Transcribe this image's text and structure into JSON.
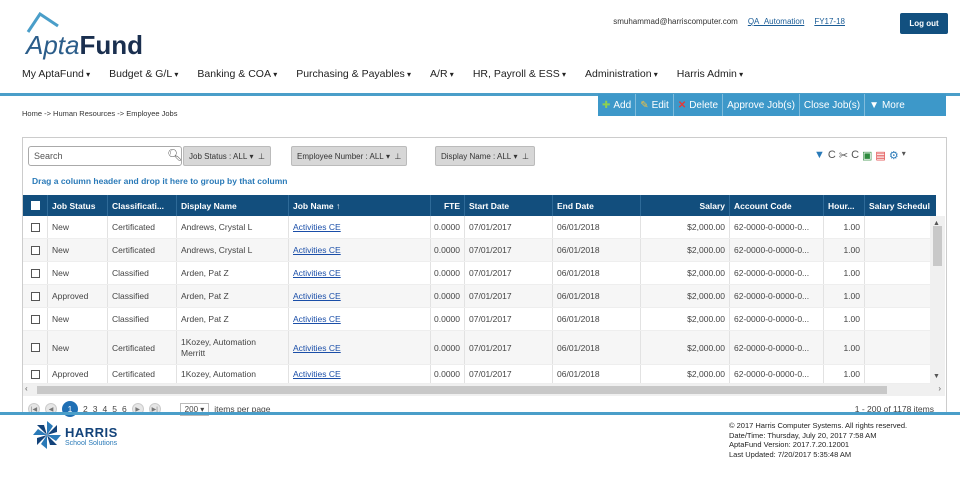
{
  "header": {
    "logo_apta": "Apta",
    "logo_fund": "Fund",
    "email": "smuhammad@harriscomputer.com",
    "user_link": "QA_Automation",
    "fy_link": "FY17-18",
    "logout": "Log out"
  },
  "nav": [
    "My AptaFund",
    "Budget & G/L",
    "Banking & COA",
    "Purchasing & Payables",
    "A/R",
    "HR, Payroll & ESS",
    "Administration",
    "Harris Admin"
  ],
  "breadcrumb": "Home -> Human Resources -> Employee Jobs",
  "toolbar": {
    "add": "Add",
    "edit": "Edit",
    "delete": "Delete",
    "approve": "Approve Job(s)",
    "close": "Close Job(s)",
    "more": "More"
  },
  "search_placeholder": "Search",
  "filters": [
    "Job Status : ALL",
    "Employee Number : ALL",
    "Display Name : ALL"
  ],
  "group_hint": "Drag a column header and drop it here to group by that column",
  "columns": [
    "Job Status",
    "Classificati...",
    "Display Name",
    "Job Name ↑",
    "FTE",
    "Start Date",
    "End Date",
    "Salary",
    "Account Code",
    "Hour...",
    "Salary Schedul"
  ],
  "rows": [
    {
      "status": "New",
      "cls": "Certificated",
      "name": "Andrews, Crystal L",
      "name2": "",
      "job": "Activities CE",
      "fte": "0.0000",
      "start": "07/01/2017",
      "end": "06/01/2018",
      "salary": "$2,000.00",
      "acct": "62-0000-0-0000-0...",
      "hours": "1.00"
    },
    {
      "status": "New",
      "cls": "Certificated",
      "name": "Andrews, Crystal L",
      "name2": "",
      "job": "Activities CE",
      "fte": "0.0000",
      "start": "07/01/2017",
      "end": "06/01/2018",
      "salary": "$2,000.00",
      "acct": "62-0000-0-0000-0...",
      "hours": "1.00"
    },
    {
      "status": "New",
      "cls": "Classified",
      "name": "Arden, Pat Z",
      "name2": "",
      "job": "Activities CE",
      "fte": "0.0000",
      "start": "07/01/2017",
      "end": "06/01/2018",
      "salary": "$2,000.00",
      "acct": "62-0000-0-0000-0...",
      "hours": "1.00"
    },
    {
      "status": "Approved",
      "cls": "Classified",
      "name": "Arden, Pat Z",
      "name2": "",
      "job": "Activities CE",
      "fte": "0.0000",
      "start": "07/01/2017",
      "end": "06/01/2018",
      "salary": "$2,000.00",
      "acct": "62-0000-0-0000-0...",
      "hours": "1.00"
    },
    {
      "status": "New",
      "cls": "Classified",
      "name": "Arden, Pat Z",
      "name2": "",
      "job": "Activities CE",
      "fte": "0.0000",
      "start": "07/01/2017",
      "end": "06/01/2018",
      "salary": "$2,000.00",
      "acct": "62-0000-0-0000-0...",
      "hours": "1.00"
    },
    {
      "status": "New",
      "cls": "Certificated",
      "name": "1Kozey, Automation",
      "name2": "Merritt",
      "job": "Activities CE",
      "fte": "0.0000",
      "start": "07/01/2017",
      "end": "06/01/2018",
      "salary": "$2,000.00",
      "acct": "62-0000-0-0000-0...",
      "hours": "1.00"
    },
    {
      "status": "Approved",
      "cls": "Certificated",
      "name": "1Kozey, Automation",
      "name2": "",
      "job": "Activities CE",
      "fte": "0.0000",
      "start": "07/01/2017",
      "end": "06/01/2018",
      "salary": "$2,000.00",
      "acct": "62-0000-0-0000-0...",
      "hours": "1.00"
    }
  ],
  "pager": {
    "pages": [
      "1",
      "2",
      "3",
      "4",
      "5",
      "6"
    ],
    "per_page": "200",
    "per_page_label": "items per page",
    "count": "1 - 200 of 1178 items"
  },
  "footer": {
    "harris": "HARRIS",
    "harris_sub": "School Solutions",
    "copyright": "© 2017 Harris Computer Systems. All rights reserved.",
    "datetime": "Date/Time: Thursday, July 20, 2017 7:58 AM",
    "version": "AptaFund Version: 2017.7.20.12001",
    "updated": "Last Updated: 7/20/2017 5:35:48 AM"
  },
  "colors": {
    "primary": "#124e7d",
    "accent": "#3d98c9",
    "link": "#1a4ea8"
  }
}
